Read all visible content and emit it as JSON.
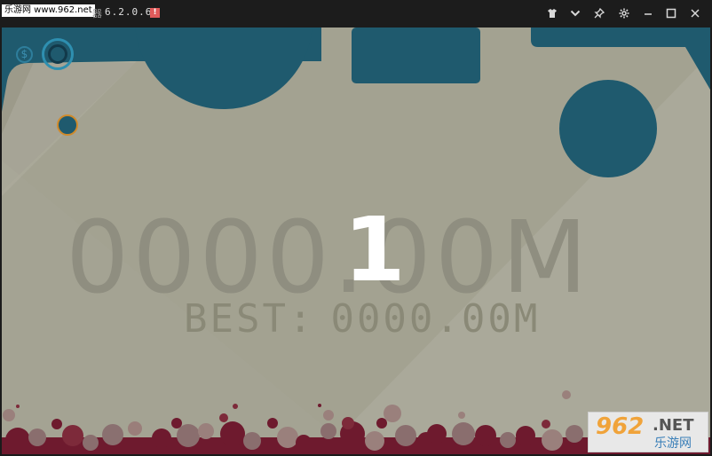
{
  "window": {
    "watermark_badge": "乐游网 www.962.net",
    "title_prefix": "器",
    "version": "6.2.0.6",
    "alert_badge": "!",
    "controls": [
      "shirt-icon",
      "chevron-down-icon",
      "pin-icon",
      "gear-icon",
      "minimize-icon",
      "maximize-icon",
      "close-icon"
    ]
  },
  "game": {
    "distance": "0000.00M",
    "best_label": "BEST:",
    "best_value": "0000.00M",
    "countdown": "1",
    "coin_symbol": "$",
    "colors": {
      "background": "#a3a291",
      "platform": "#1f5a6e",
      "blood": "#6e1a2e",
      "text": "#8f8e80"
    }
  },
  "watermark": {
    "number": "962",
    "suffix": ".NET",
    "site_name": "乐游网"
  }
}
